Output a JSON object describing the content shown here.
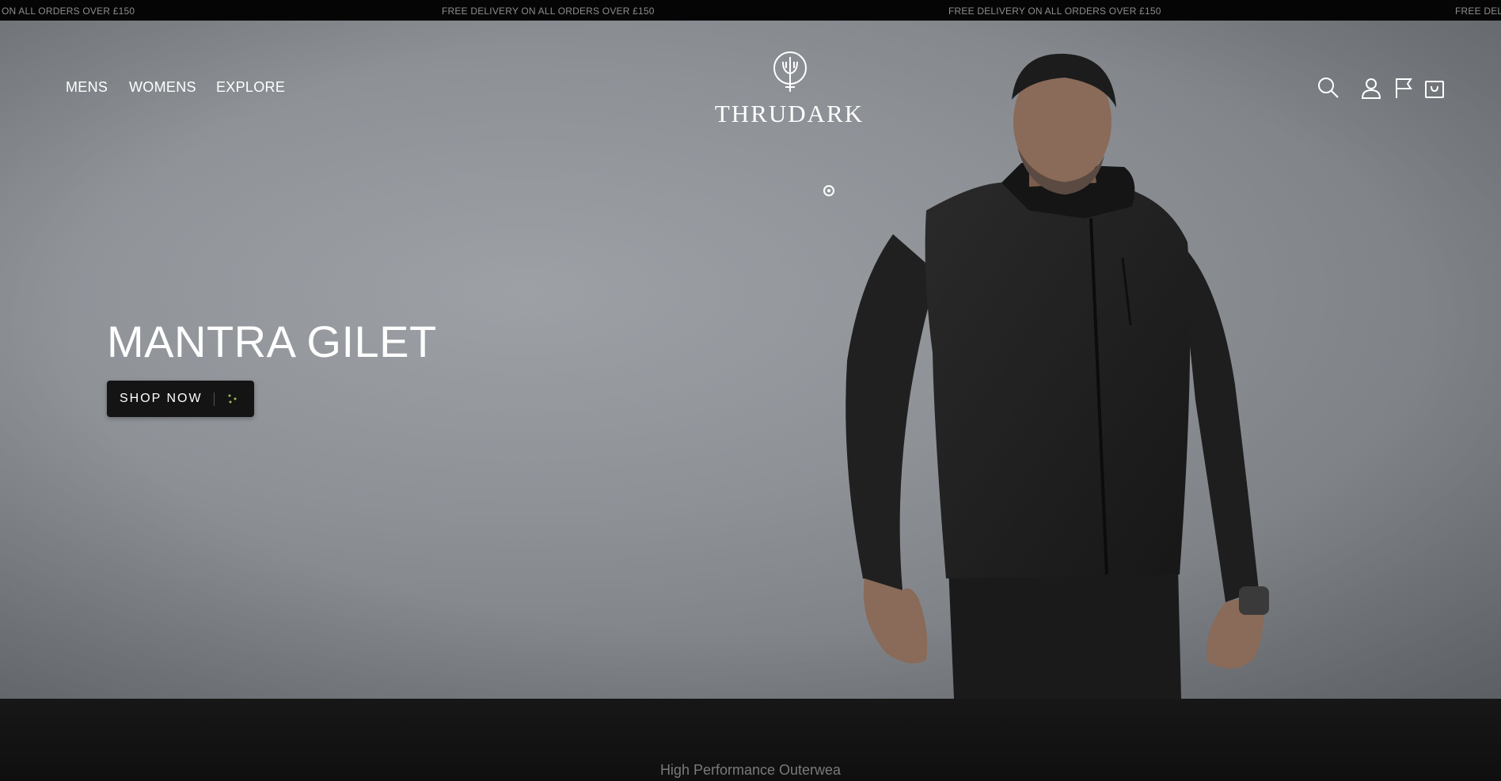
{
  "announcement": {
    "messages": [
      "ON ALL ORDERS OVER £150",
      "FREE DELIVERY ON ALL ORDERS OVER £150",
      "FREE DELIVERY ON ALL ORDERS OVER £150",
      "FREE DELIV"
    ]
  },
  "header": {
    "nav": [
      "MENS",
      "WOMENS",
      "EXPLORE"
    ],
    "brand": "THRUDARK",
    "icons": [
      "search-icon",
      "account-icon",
      "flag-icon",
      "bag-icon"
    ]
  },
  "hero": {
    "title": "MANTRA GILET",
    "cta_label": "SHOP NOW",
    "slide_count": 1,
    "active_slide": 1
  },
  "section": {
    "text": "High Performance Outerwea"
  },
  "colors": {
    "bar": "#050505",
    "button": "#141414",
    "accent_dots": "#9bbf5a",
    "text": "#ffffff"
  }
}
